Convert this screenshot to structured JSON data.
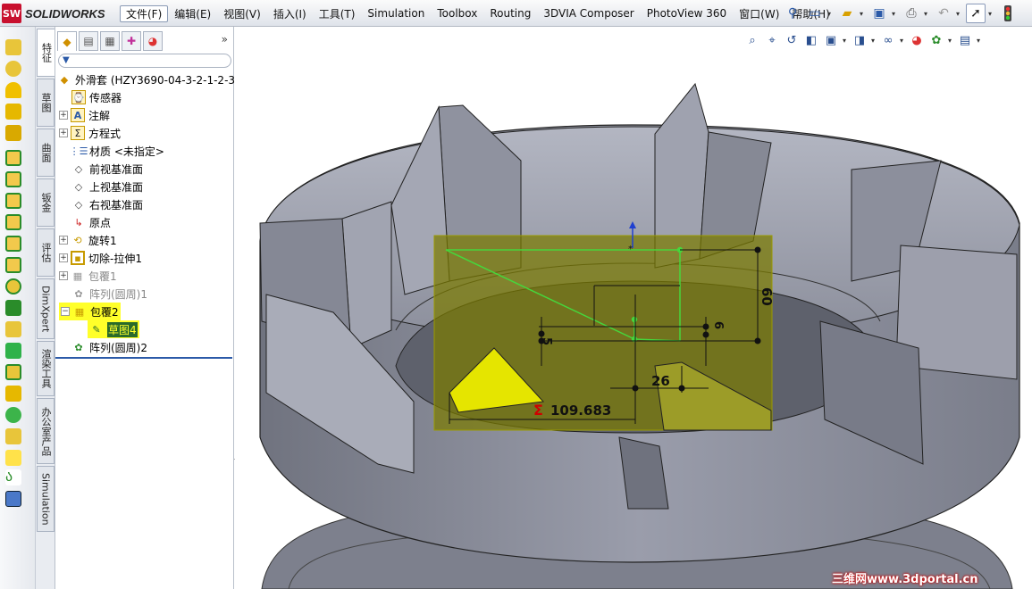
{
  "app": {
    "logo_text": "SOLIDWORKS"
  },
  "menu": {
    "items": [
      "文件(F)",
      "编辑(E)",
      "视图(V)",
      "插入(I)",
      "工具(T)",
      "Simulation",
      "Toolbox",
      "Routing",
      "3DVIA Composer",
      "PhotoView 360",
      "窗口(W)",
      "帮助(H)"
    ]
  },
  "side_tabs": [
    "特征",
    "草图",
    "曲面",
    "钣金",
    "评估",
    "DimXpert",
    "渲染工具",
    "办公室产品",
    "Simulation"
  ],
  "tree": {
    "root": "外滑套  (HZY3690-04-3-2-1-2-3",
    "items": [
      {
        "label": "传感器"
      },
      {
        "label": "注解"
      },
      {
        "label": "方程式"
      },
      {
        "label": "材质 <未指定>"
      },
      {
        "label": "前视基准面"
      },
      {
        "label": "上视基准面"
      },
      {
        "label": "右视基准面"
      },
      {
        "label": "原点"
      },
      {
        "label": "旋转1"
      },
      {
        "label": "切除-拉伸1"
      },
      {
        "label": "包覆1"
      },
      {
        "label": "阵列(圆周)1"
      },
      {
        "label": "包覆2"
      },
      {
        "label": "草图4"
      },
      {
        "label": "阵列(圆周)2"
      }
    ]
  },
  "sketch": {
    "dim_main": "109.683",
    "dim_26": "26",
    "dim_60": "60",
    "dim_5": "5",
    "dim_6": "6",
    "sigma": "Σ"
  },
  "watermark": "三维网www.3dportal.cn",
  "colors": {
    "highlight": "#ffff2a",
    "sketch_plane": "#7a7a00",
    "model_face": "#8a8d9b",
    "sketch_line": "#46d63c"
  }
}
